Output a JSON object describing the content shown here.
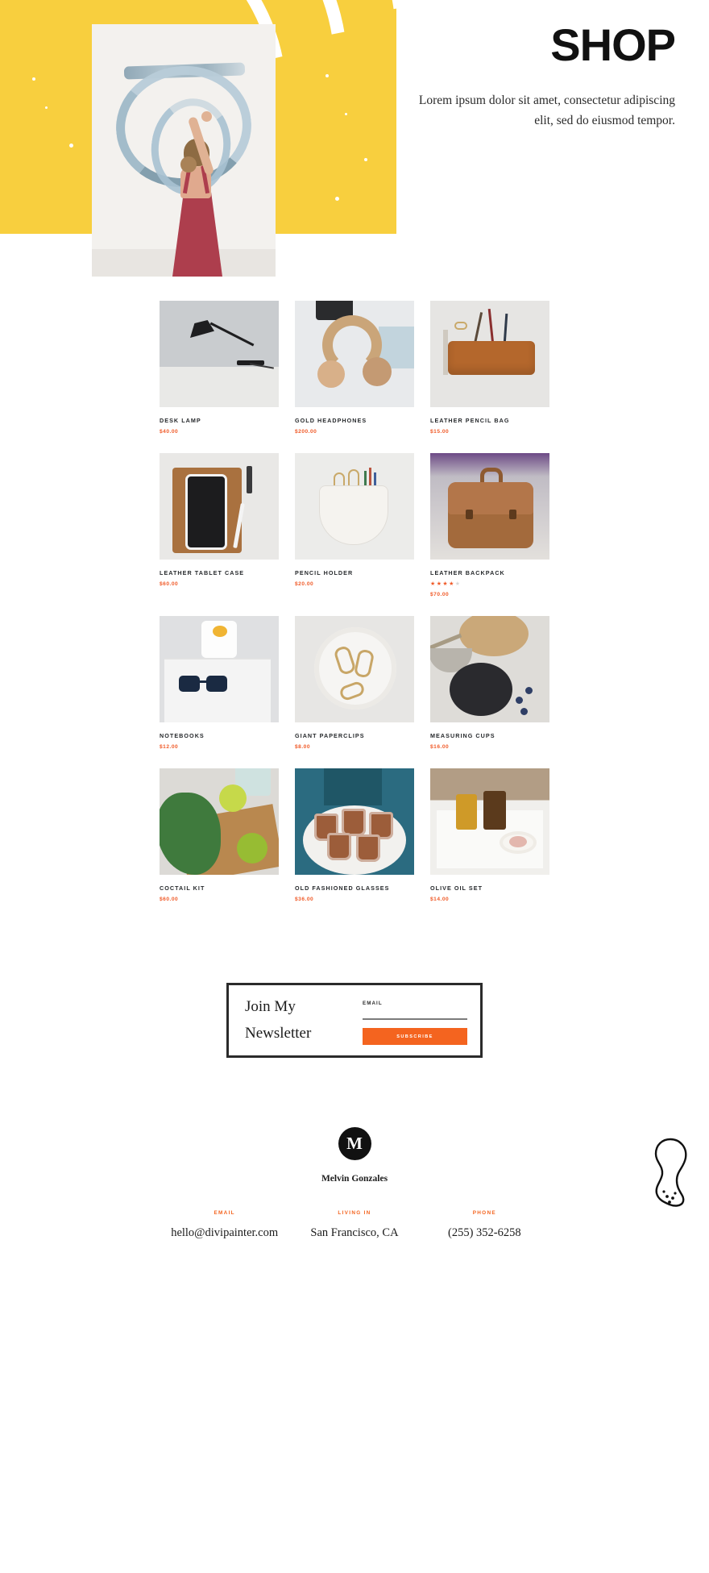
{
  "hero": {
    "title": "SHOP",
    "subtitle": "Lorem ipsum dolor sit amet, consectetur adipiscing elit, sed do eiusmod tempor.",
    "photo_alt": "woman-painting-canvas",
    "accent_yellow": "#f8cf3e"
  },
  "colors": {
    "accent_orange": "#f4641f",
    "price_orange": "#f05a28",
    "dark": "#1c1c1c",
    "yellow": "#f8cf3e",
    "star_off": "#d6d6d6"
  },
  "products": [
    {
      "name": "DESK LAMP",
      "price": "$40.00",
      "rating": null,
      "image": "desk-lamp"
    },
    {
      "name": "GOLD HEADPHONES",
      "price": "$200.00",
      "rating": null,
      "image": "gold-headphones"
    },
    {
      "name": "LEATHER PENCIL BAG",
      "price": "$15.00",
      "rating": null,
      "image": "leather-pencil-bag"
    },
    {
      "name": "LEATHER TABLET CASE",
      "price": "$60.00",
      "rating": null,
      "image": "leather-tablet-case"
    },
    {
      "name": "PENCIL HOLDER",
      "price": "$20.00",
      "rating": null,
      "image": "pencil-holder"
    },
    {
      "name": "LEATHER BACKPACK",
      "price": "$70.00",
      "rating": 4,
      "image": "leather-backpack"
    },
    {
      "name": "NOTEBOOKS",
      "price": "$12.00",
      "rating": null,
      "image": "notebooks"
    },
    {
      "name": "GIANT PAPERCLIPS",
      "price": "$8.00",
      "rating": null,
      "image": "giant-paperclips"
    },
    {
      "name": "MEASURING CUPS",
      "price": "$16.00",
      "rating": null,
      "image": "measuring-cups"
    },
    {
      "name": "COCTAIL KIT",
      "price": "$60.00",
      "rating": null,
      "image": "coctail-kit"
    },
    {
      "name": "OLD FASHIONED GLASSES",
      "price": "$36.00",
      "rating": null,
      "image": "old-fashioned-glasses"
    },
    {
      "name": "OLIVE OIL SET",
      "price": "$14.00",
      "rating": null,
      "image": "olive-oil-set"
    }
  ],
  "newsletter": {
    "title_line1": "Join My",
    "title_line2": "Newsletter",
    "email_label": "EMAIL",
    "email_value": "",
    "email_placeholder": "",
    "button_label": "SUBSCRIBE"
  },
  "footer": {
    "logo_letter": "M",
    "name": "Melvin Gonzales",
    "contacts": [
      {
        "label": "EMAIL",
        "value": "hello@divipainter.com"
      },
      {
        "label": "LIVING IN",
        "value": "San Francisco, CA"
      },
      {
        "label": "PHONE",
        "value": "(255) 352-6258"
      }
    ],
    "decoration": "peanut-outline-doodle"
  }
}
